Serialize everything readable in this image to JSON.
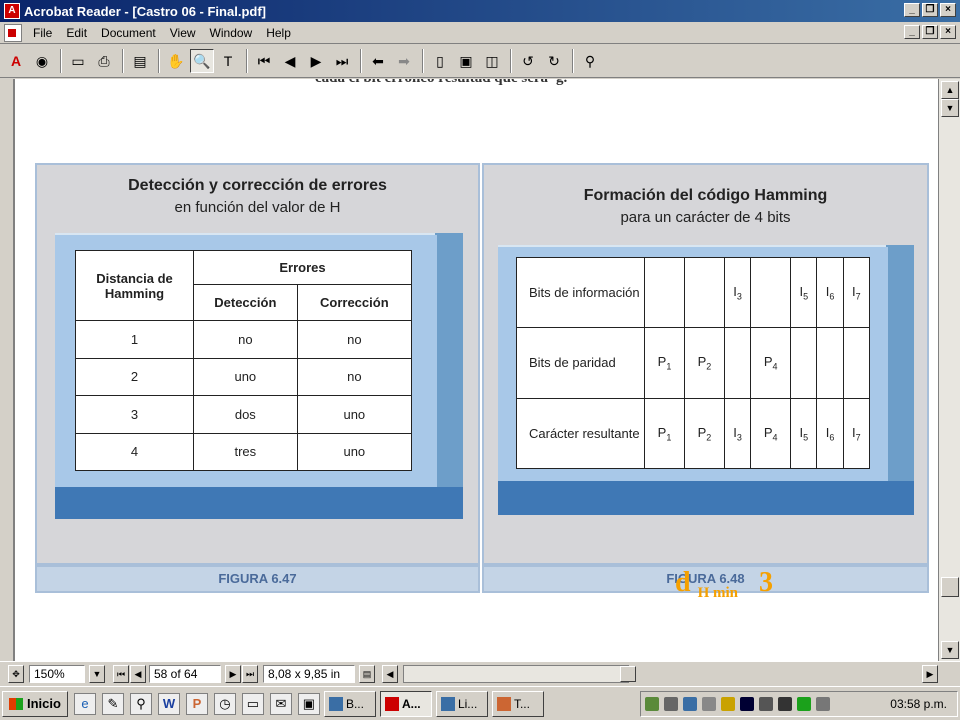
{
  "window": {
    "title": "Acrobat Reader - [Castro 06 - Final.pdf]"
  },
  "menu": [
    "File",
    "Edit",
    "Document",
    "View",
    "Window",
    "Help"
  ],
  "toolbar_icons": [
    "acrobat-logo-icon",
    "globe-icon",
    "open-icon",
    "print-icon",
    "show-bookmarks-icon",
    "hand-tool-icon",
    "zoom-tool-icon",
    "text-select-tool-icon",
    "first-page-icon",
    "previous-page-icon",
    "next-page-icon",
    "last-page-icon",
    "go-back-icon",
    "go-forward-icon",
    "actual-size-icon",
    "fit-page-icon",
    "fit-width-icon",
    "rotate-left-icon",
    "rotate-right-icon",
    "find-icon"
  ],
  "page": {
    "cut_text": "cada el bit erróneo resultad que será 'g.",
    "fig47": {
      "title": "Detección y corrección de errores",
      "subtitle": "en función del valor de H",
      "caption": "FIGURA 6.47",
      "header_distance": "Distancia de Hamming",
      "header_errors": "Errores",
      "header_detection": "Detección",
      "header_correction": "Corrección",
      "rows": [
        {
          "d": "1",
          "det": "no",
          "cor": "no"
        },
        {
          "d": "2",
          "det": "uno",
          "cor": "no"
        },
        {
          "d": "3",
          "det": "dos",
          "cor": "uno"
        },
        {
          "d": "4",
          "det": "tres",
          "cor": "uno"
        }
      ]
    },
    "fig48": {
      "title": "Formación del código Hamming",
      "subtitle": "para un carácter de 4 bits",
      "caption": "FIGURA 6.48",
      "rows": [
        {
          "label": "Bits de información",
          "cells": [
            [
              "",
              ""
            ],
            [
              "",
              ""
            ],
            [
              "I",
              "3"
            ],
            [
              "",
              ""
            ],
            [
              "I",
              "5"
            ],
            [
              "I",
              "6"
            ],
            [
              "I",
              "7"
            ]
          ]
        },
        {
          "label": "Bits de paridad",
          "cells": [
            [
              "P",
              "1"
            ],
            [
              "P",
              "2"
            ],
            [
              "",
              ""
            ],
            [
              "P",
              "4"
            ],
            [
              "",
              ""
            ],
            [
              "",
              ""
            ],
            [
              "",
              ""
            ]
          ]
        },
        {
          "label": "Carácter resultante",
          "cells": [
            [
              "P",
              "1"
            ],
            [
              "P",
              "2"
            ],
            [
              "I",
              "3"
            ],
            [
              "P",
              "4"
            ],
            [
              "I",
              "5"
            ],
            [
              "I",
              "6"
            ],
            [
              "I",
              "7"
            ]
          ]
        }
      ]
    },
    "formula": {
      "d": "d",
      "sub": "H min",
      "value": "3"
    }
  },
  "status": {
    "zoom": "150%",
    "page_label": "58 of 64",
    "page_size": "8,08 x 9,85 in"
  },
  "taskbar": {
    "start": "Inicio",
    "tasks": [
      "B...",
      "A...",
      "Li...",
      "T..."
    ],
    "clock": "03:58 p.m."
  }
}
